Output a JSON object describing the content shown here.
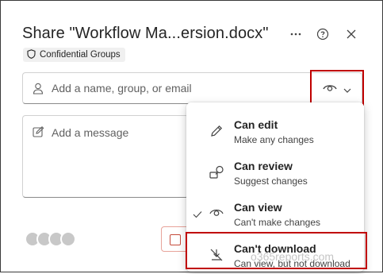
{
  "dialog": {
    "title": "Share \"Workflow Ma...ersion.docx\"",
    "sensitivity_label": "Confidential Groups"
  },
  "header_icons": {
    "more": "more-options-icon",
    "help": "help-icon",
    "close": "close-icon"
  },
  "recipients": {
    "placeholder": "Add a name, group, or email"
  },
  "message": {
    "placeholder": "Add a message"
  },
  "permission_menu": {
    "items": [
      {
        "label": "Can edit",
        "description": "Make any changes",
        "icon": "pencil-icon",
        "selected": false
      },
      {
        "label": "Can review",
        "description": "Suggest changes",
        "icon": "review-icon",
        "selected": false
      },
      {
        "label": "Can view",
        "description": "Can't make changes",
        "icon": "eye-icon",
        "selected": true
      },
      {
        "label": "Can't download",
        "description": "Can view, but not download",
        "icon": "no-download-icon",
        "selected": false
      }
    ]
  },
  "watermark": "o365reports.com",
  "colors": {
    "highlight": "#c00000",
    "text": "#242424",
    "border": "#d1d1d1"
  }
}
